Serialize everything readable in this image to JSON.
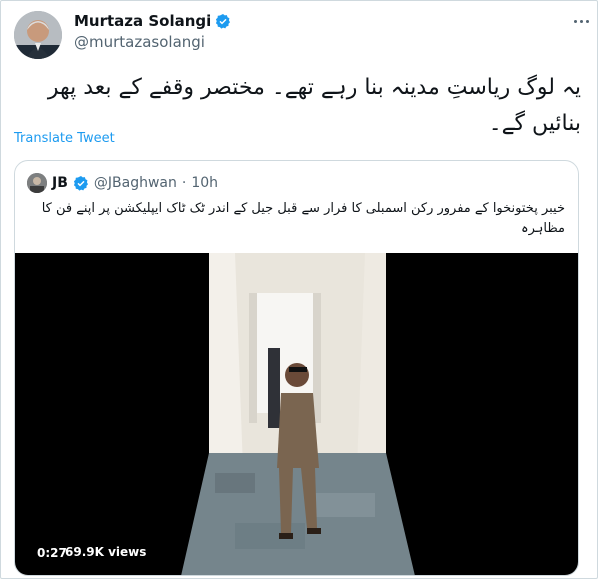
{
  "tweet": {
    "author_name": "Murtaza Solangi",
    "author_handle": "@murtazasolangi",
    "text": "یہ لوگ ریاستِ مدینہ بنا رہے تھے۔ مختصر وقفے کے بعد پھر بنائیں گے۔",
    "translate_label": "Translate Tweet",
    "more_icon": "more-horizontal-icon",
    "verified_icon": "verified-badge-icon"
  },
  "quoted": {
    "author_name": "JB",
    "author_handle": "@JBaghwan",
    "separator": "·",
    "time": "10h",
    "text": "خیبر پختونخوا کے مفرور رکن اسمبلی کا فرار سے قبل جیل کے اندر ٹک ٹاک ایپلیکشن پر اپنے فن کا مظاہرہ",
    "video": {
      "duration": "0:27",
      "views": "69.9K views"
    }
  },
  "colors": {
    "accent": "#1d9bf0",
    "border": "#cfd9de",
    "muted_text": "#536471"
  }
}
